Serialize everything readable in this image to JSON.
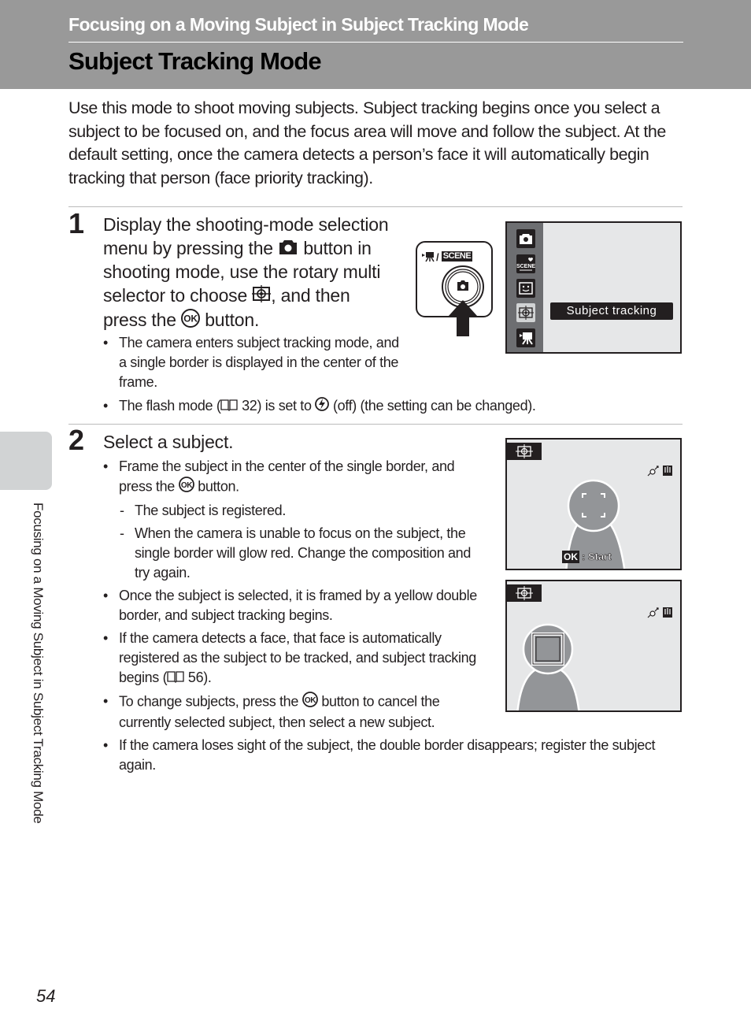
{
  "header": {
    "section": "Focusing on a Moving Subject in Subject Tracking Mode",
    "title": "Subject Tracking Mode"
  },
  "intro": "Use this mode to shoot moving subjects. Subject tracking begins once you select a subject to be focused on, and the focus area will move and follow the subject. At the default setting, once the camera detects a person’s face it will automatically begin tracking that person (face priority tracking).",
  "steps": [
    {
      "number": "1",
      "heading_parts": {
        "a": "Display the shooting-mode selection menu by pressing the",
        "b": "button in shooting mode, use the rotary multi selector to choose",
        "c": ",",
        "d": "and then press the",
        "e": "button."
      },
      "bullets": [
        "The camera enters subject tracking mode, and a single border is displayed in the center of the frame.",
        {
          "a": "The flash mode (",
          "ref": "32",
          "b": ") is set to",
          "c": "(off) (the setting can be changed)."
        }
      ],
      "illustration": {
        "button_label": "SCENE",
        "menu_selected_label": "Subject tracking",
        "menu_icons": [
          "camera-icon",
          "scene-icon",
          "smart-portrait-icon",
          "subject-tracking-icon",
          "movie-icon"
        ]
      }
    },
    {
      "number": "2",
      "heading": "Select a subject.",
      "bullets": {
        "b1_a": "Frame the subject in the center of the single border, and press the",
        "b1_b": "button.",
        "sub1": "The subject is registered.",
        "sub2": "When the camera is unable to focus on the subject, the single border will glow red. Change the composition and try again.",
        "b2": "Once the subject is selected, it is framed by a yellow double border, and subject tracking begins.",
        "b3_a": "If the camera detects a face, that face is automatically registered as the subject to be tracked, and subject tracking begins (",
        "b3_ref": "56",
        "b3_b": ").",
        "b4_a": "To change subjects, press the",
        "b4_b": "button to cancel the currently selected subject, then select a new subject.",
        "b5": "If the camera loses sight of the subject, the double border disappears; register the subject again."
      },
      "screens": {
        "ok_label": "OK",
        "start_label": ": Start"
      }
    }
  ],
  "side_tab_text": "Focusing on a Moving Subject in Subject Tracking Mode",
  "page_number": "54"
}
